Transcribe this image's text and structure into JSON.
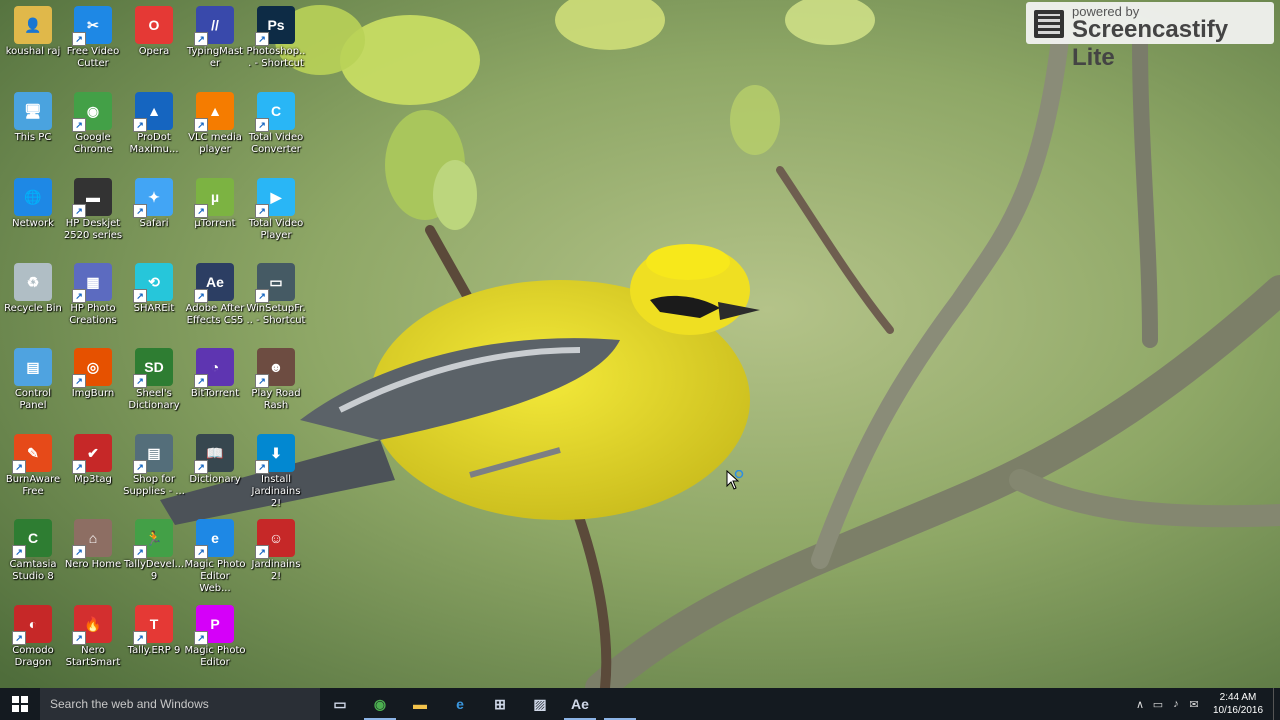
{
  "desktop": {
    "icons": [
      {
        "label": "koushal raj",
        "icon": "user-folder-icon",
        "color": "#e0b84a",
        "glyph": "👤"
      },
      {
        "label": "Free Video Cutter",
        "icon": "scissors-icon",
        "color": "#1e88e5",
        "glyph": "✂"
      },
      {
        "label": "Opera",
        "icon": "opera-icon",
        "color": "#e53935",
        "glyph": "O"
      },
      {
        "label": "TypingMaster",
        "icon": "typingmaster-icon",
        "color": "#3949ab",
        "glyph": "//"
      },
      {
        "label": "Photoshop... - Shortcut",
        "icon": "photoshop-icon",
        "color": "#0d2b45",
        "glyph": "Ps"
      },
      {
        "label": "This PC",
        "icon": "computer-icon",
        "color": "#4aa3df",
        "glyph": "🖥"
      },
      {
        "label": "Google Chrome",
        "icon": "chrome-icon",
        "color": "#43a047",
        "glyph": "◉"
      },
      {
        "label": "ProDot Maximu...",
        "icon": "prodot-icon",
        "color": "#1565c0",
        "glyph": "▲"
      },
      {
        "label": "VLC media player",
        "icon": "vlc-icon",
        "color": "#f57c00",
        "glyph": "▲"
      },
      {
        "label": "Total Video Converter",
        "icon": "converter-icon",
        "color": "#29b6f6",
        "glyph": "C"
      },
      {
        "label": "Network",
        "icon": "network-icon",
        "color": "#1e88e5",
        "glyph": "🌐"
      },
      {
        "label": "HP Deskjet 2520 series",
        "icon": "printer-icon",
        "color": "#333333",
        "glyph": "▬"
      },
      {
        "label": "Safari",
        "icon": "safari-icon",
        "color": "#42a5f5",
        "glyph": "✦"
      },
      {
        "label": "µTorrent",
        "icon": "utorrent-icon",
        "color": "#7cb342",
        "glyph": "µ"
      },
      {
        "label": "Total Video Player",
        "icon": "video-player-icon",
        "color": "#29b6f6",
        "glyph": "▶"
      },
      {
        "label": "Recycle Bin",
        "icon": "recycle-bin-icon",
        "color": "#b0bec5",
        "glyph": "♻"
      },
      {
        "label": "HP Photo Creations",
        "icon": "photo-icon",
        "color": "#5c6bc0",
        "glyph": "▦"
      },
      {
        "label": "SHAREit",
        "icon": "shareit-icon",
        "color": "#26c6da",
        "glyph": "⟲"
      },
      {
        "label": "Adobe After Effects CS5",
        "icon": "after-effects-icon",
        "color": "#2c3e63",
        "glyph": "Ae"
      },
      {
        "label": "WinSetupFr... - Shortcut",
        "icon": "usb-icon",
        "color": "#455a64",
        "glyph": "▭"
      },
      {
        "label": "Control Panel",
        "icon": "control-panel-icon",
        "color": "#4fa3e0",
        "glyph": "▤"
      },
      {
        "label": "ImgBurn",
        "icon": "imgburn-icon",
        "color": "#e65100",
        "glyph": "◎"
      },
      {
        "label": "Sheel's Dictionary",
        "icon": "dictionary-sd-icon",
        "color": "#2e7d32",
        "glyph": "SD"
      },
      {
        "label": "BitTorrent",
        "icon": "bittorrent-icon",
        "color": "#5e35b1",
        "glyph": "◔"
      },
      {
        "label": "Play Road Rash",
        "icon": "road-rash-icon",
        "color": "#6d4c41",
        "glyph": "☻"
      },
      {
        "label": "BurnAware Free",
        "icon": "burnaware-icon",
        "color": "#e64a19",
        "glyph": "✎"
      },
      {
        "label": "Mp3tag",
        "icon": "mp3tag-icon",
        "color": "#c62828",
        "glyph": "✔"
      },
      {
        "label": "Shop for Supplies - ...",
        "icon": "shop-icon",
        "color": "#546e7a",
        "glyph": "▤"
      },
      {
        "label": "Dictionary",
        "icon": "book-icon",
        "color": "#37474f",
        "glyph": "📖"
      },
      {
        "label": "Install Jardinains 2!",
        "icon": "installer-icon",
        "color": "#0288d1",
        "glyph": "⬇"
      },
      {
        "label": "Camtasia Studio 8",
        "icon": "camtasia-icon",
        "color": "#2e7d32",
        "glyph": "C"
      },
      {
        "label": "Nero Home",
        "icon": "nero-home-icon",
        "color": "#8d6e63",
        "glyph": "⌂"
      },
      {
        "label": "TallyDevel... 9",
        "icon": "tally-dev-icon",
        "color": "#43a047",
        "glyph": "🏃"
      },
      {
        "label": "Magic Photo Editor Web...",
        "icon": "ie-icon",
        "color": "#1e88e5",
        "glyph": "e"
      },
      {
        "label": "Jardinains 2!",
        "icon": "gnome-icon",
        "color": "#c62828",
        "glyph": "☺"
      },
      {
        "label": "Comodo Dragon",
        "icon": "comodo-icon",
        "color": "#c62828",
        "glyph": "◐"
      },
      {
        "label": "Nero StartSmart",
        "icon": "nero-icon",
        "color": "#d32f2f",
        "glyph": "🔥"
      },
      {
        "label": "Tally.ERP 9",
        "icon": "tally-icon",
        "color": "#e53935",
        "glyph": "T"
      },
      {
        "label": "Magic Photo Editor",
        "icon": "magic-photo-icon",
        "color": "#d500f9",
        "glyph": "P"
      }
    ]
  },
  "overlay": {
    "powered_by": "powered by",
    "brand": "Screencastify Lite"
  },
  "taskbar": {
    "search_placeholder": "Search the web and Windows",
    "apps": [
      {
        "name": "task-view-button",
        "icon": "task-view-icon",
        "glyph": "▭",
        "active": false
      },
      {
        "name": "chrome-taskbar-button",
        "icon": "chrome-icon",
        "glyph": "◉",
        "active": true
      },
      {
        "name": "file-explorer-taskbar-button",
        "icon": "folder-icon",
        "glyph": "▬",
        "active": false
      },
      {
        "name": "edge-taskbar-button",
        "icon": "edge-icon",
        "glyph": "e",
        "active": false
      },
      {
        "name": "store-taskbar-button",
        "icon": "store-icon",
        "glyph": "⊞",
        "active": false
      },
      {
        "name": "photos-taskbar-button",
        "icon": "photos-icon",
        "glyph": "▨",
        "active": false
      },
      {
        "name": "after-effects-taskbar-button",
        "icon": "after-effects-icon",
        "glyph": "Ae",
        "active": true
      },
      {
        "name": "blank-taskbar-button",
        "icon": "window-icon",
        "glyph": "",
        "active": true
      }
    ],
    "tray": {
      "icons": [
        "chevron-up-icon",
        "network-icon",
        "volume-icon",
        "message-icon"
      ],
      "glyphs": [
        "∧",
        "▭",
        "♪",
        "✉"
      ],
      "time": "2:44 AM",
      "date": "10/16/2016"
    }
  }
}
